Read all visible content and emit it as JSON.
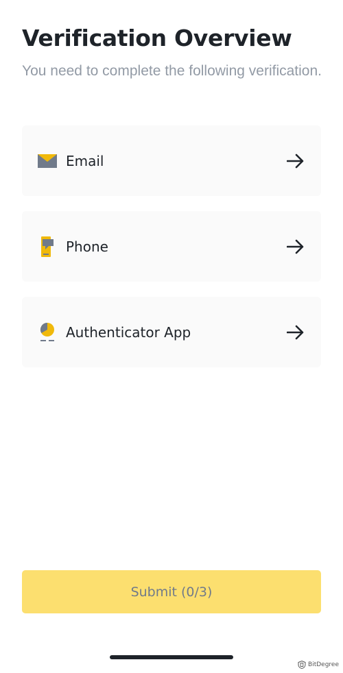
{
  "header": {
    "title": "Verification Overview",
    "subtitle": "You need to complete the following verification."
  },
  "options": [
    {
      "label": "Email",
      "icon": "email-icon"
    },
    {
      "label": "Phone",
      "icon": "phone-icon"
    },
    {
      "label": "Authenticator App",
      "icon": "authenticator-icon"
    }
  ],
  "submit": {
    "label": "Submit (0/3)",
    "completed": 0,
    "total": 3
  },
  "watermark": {
    "text": "BitDegree"
  },
  "colors": {
    "brand_yellow": "#F0B90B",
    "button_yellow": "#FCDF6F",
    "icon_gray": "#707A8A",
    "text_primary": "#1E2329",
    "text_secondary": "#929AA5",
    "card_bg": "#FAFAFA"
  }
}
